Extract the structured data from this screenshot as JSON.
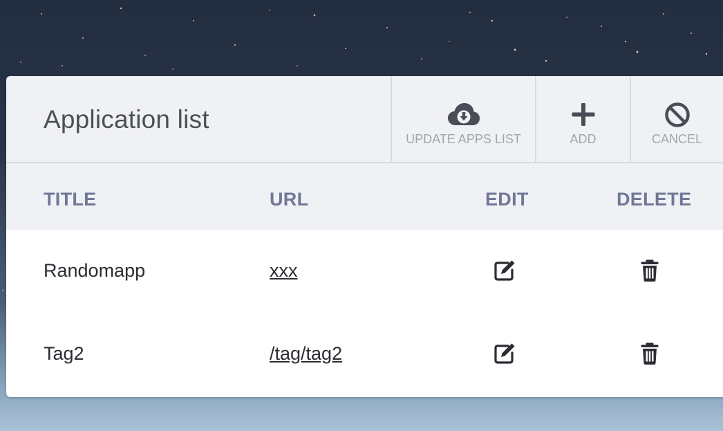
{
  "header": {
    "title": "Application list",
    "buttons": {
      "update": {
        "label": "UPDATE APPS LIST",
        "icon": "cloud-download-icon"
      },
      "add": {
        "label": "ADD",
        "icon": "plus-icon"
      },
      "cancel": {
        "label": "CANCEL",
        "icon": "ban-icon"
      }
    }
  },
  "table": {
    "columns": [
      "TITLE",
      "URL",
      "EDIT",
      "DELETE"
    ],
    "rows": [
      {
        "title": "Randomapp",
        "url": "xxx",
        "edit_icon": "edit-icon",
        "delete_icon": "trash-icon"
      },
      {
        "title": "Tag2",
        "url": "/tag/tag2",
        "edit_icon": "edit-icon",
        "delete_icon": "trash-icon"
      }
    ]
  },
  "colors": {
    "header_bg": "#f0f1f5",
    "column_header_text": "#707895",
    "button_text": "#a3a6ad",
    "icon_color": "#4a4d57"
  }
}
